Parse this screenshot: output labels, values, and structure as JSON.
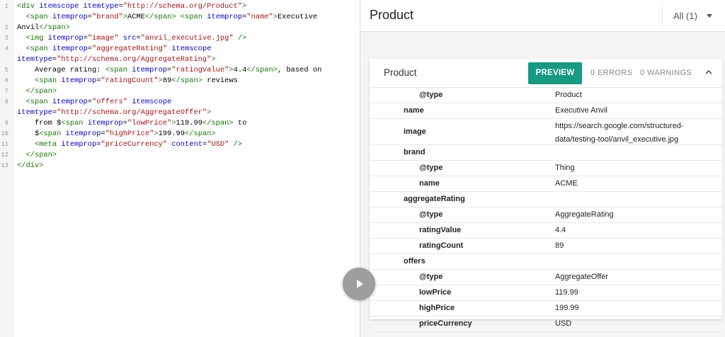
{
  "code": {
    "lines": [
      [
        {
          "t": "tag",
          "s": "<div "
        },
        {
          "t": "attr",
          "s": "itemscope itemtype"
        },
        {
          "t": "txt",
          "s": "="
        },
        {
          "t": "str",
          "s": "\"http://schema.org/Product\""
        },
        {
          "t": "tag",
          "s": ">"
        }
      ],
      [
        {
          "t": "txt",
          "s": "  "
        },
        {
          "t": "tag",
          "s": "<span "
        },
        {
          "t": "attr",
          "s": "itemprop"
        },
        {
          "t": "txt",
          "s": "="
        },
        {
          "t": "str",
          "s": "\"brand\""
        },
        {
          "t": "tag",
          "s": ">"
        },
        {
          "t": "txt",
          "s": "ACME"
        },
        {
          "t": "tag",
          "s": "</span>"
        },
        {
          "t": "txt",
          "s": " "
        },
        {
          "t": "tag",
          "s": "<span "
        },
        {
          "t": "attr",
          "s": "itemprop"
        },
        {
          "t": "txt",
          "s": "="
        },
        {
          "t": "str",
          "s": "\"name\""
        },
        {
          "t": "tag",
          "s": ">"
        },
        {
          "t": "txt",
          "s": "Executive"
        }
      ],
      [
        {
          "t": "txt",
          "s": "Anvil"
        },
        {
          "t": "tag",
          "s": "</span>"
        }
      ],
      [
        {
          "t": "txt",
          "s": "  "
        },
        {
          "t": "tag",
          "s": "<img "
        },
        {
          "t": "attr",
          "s": "itemprop"
        },
        {
          "t": "txt",
          "s": "="
        },
        {
          "t": "str",
          "s": "\"image\""
        },
        {
          "t": "txt",
          "s": " "
        },
        {
          "t": "attr",
          "s": "src"
        },
        {
          "t": "txt",
          "s": "="
        },
        {
          "t": "str",
          "s": "\"anvil_executive.jpg\""
        },
        {
          "t": "txt",
          "s": " "
        },
        {
          "t": "tag",
          "s": "/>"
        }
      ],
      [
        {
          "t": "txt",
          "s": "  "
        },
        {
          "t": "tag",
          "s": "<span "
        },
        {
          "t": "attr",
          "s": "itemprop"
        },
        {
          "t": "txt",
          "s": "="
        },
        {
          "t": "str",
          "s": "\"aggregateRating\""
        },
        {
          "t": "txt",
          "s": " "
        },
        {
          "t": "attr",
          "s": "itemscope"
        }
      ],
      [
        {
          "t": "attr",
          "s": "itemtype"
        },
        {
          "t": "txt",
          "s": "="
        },
        {
          "t": "str",
          "s": "\"http://schema.org/AggregateRating\""
        },
        {
          "t": "tag",
          "s": ">"
        }
      ],
      [
        {
          "t": "txt",
          "s": "    Average rating: "
        },
        {
          "t": "tag",
          "s": "<span "
        },
        {
          "t": "attr",
          "s": "itemprop"
        },
        {
          "t": "txt",
          "s": "="
        },
        {
          "t": "str",
          "s": "\"ratingValue\""
        },
        {
          "t": "tag",
          "s": ">"
        },
        {
          "t": "txt",
          "s": "4.4"
        },
        {
          "t": "tag",
          "s": "</span>"
        },
        {
          "t": "txt",
          "s": ", based on"
        }
      ],
      [
        {
          "t": "txt",
          "s": "    "
        },
        {
          "t": "tag",
          "s": "<span "
        },
        {
          "t": "attr",
          "s": "itemprop"
        },
        {
          "t": "txt",
          "s": "="
        },
        {
          "t": "str",
          "s": "\"ratingCount\""
        },
        {
          "t": "tag",
          "s": ">"
        },
        {
          "t": "txt",
          "s": "89"
        },
        {
          "t": "tag",
          "s": "</span>"
        },
        {
          "t": "txt",
          "s": " reviews"
        }
      ],
      [
        {
          "t": "txt",
          "s": "  "
        },
        {
          "t": "tag",
          "s": "</span>"
        }
      ],
      [
        {
          "t": "txt",
          "s": "  "
        },
        {
          "t": "tag",
          "s": "<span "
        },
        {
          "t": "attr",
          "s": "itemprop"
        },
        {
          "t": "txt",
          "s": "="
        },
        {
          "t": "str",
          "s": "\"offers\""
        },
        {
          "t": "txt",
          "s": " "
        },
        {
          "t": "attr",
          "s": "itemscope"
        }
      ],
      [
        {
          "t": "attr",
          "s": "itemtype"
        },
        {
          "t": "txt",
          "s": "="
        },
        {
          "t": "str",
          "s": "\"http://schema.org/AggregateOffer\""
        },
        {
          "t": "tag",
          "s": ">"
        }
      ],
      [
        {
          "t": "txt",
          "s": "    from $"
        },
        {
          "t": "tag",
          "s": "<span "
        },
        {
          "t": "attr",
          "s": "itemprop"
        },
        {
          "t": "txt",
          "s": "="
        },
        {
          "t": "str",
          "s": "\"lowPrice\""
        },
        {
          "t": "tag",
          "s": ">"
        },
        {
          "t": "txt",
          "s": "119.99"
        },
        {
          "t": "tag",
          "s": "</span>"
        },
        {
          "t": "txt",
          "s": " to"
        }
      ],
      [
        {
          "t": "txt",
          "s": "    $"
        },
        {
          "t": "tag",
          "s": "<span "
        },
        {
          "t": "attr",
          "s": "itemprop"
        },
        {
          "t": "txt",
          "s": "="
        },
        {
          "t": "str",
          "s": "\"highPrice\""
        },
        {
          "t": "tag",
          "s": ">"
        },
        {
          "t": "txt",
          "s": "199.99"
        },
        {
          "t": "tag",
          "s": "</span>"
        }
      ],
      [
        {
          "t": "txt",
          "s": "    "
        },
        {
          "t": "tag",
          "s": "<meta "
        },
        {
          "t": "attr",
          "s": "itemprop"
        },
        {
          "t": "txt",
          "s": "="
        },
        {
          "t": "str",
          "s": "\"priceCurrency\""
        },
        {
          "t": "txt",
          "s": " "
        },
        {
          "t": "attr",
          "s": "content"
        },
        {
          "t": "txt",
          "s": "="
        },
        {
          "t": "str",
          "s": "\"USD\""
        },
        {
          "t": "txt",
          "s": " "
        },
        {
          "t": "tag",
          "s": "/>"
        }
      ],
      [
        {
          "t": "txt",
          "s": "  "
        },
        {
          "t": "tag",
          "s": "</span>"
        }
      ],
      [
        {
          "t": "tag",
          "s": "</div>"
        }
      ]
    ],
    "line_numbers": [
      "1",
      "",
      "2",
      "3",
      "4",
      "",
      "5",
      "6",
      "7",
      "8",
      "",
      "9",
      "10",
      "11",
      "12",
      "13"
    ]
  },
  "panel": {
    "title": "Product",
    "filter": "All (1)"
  },
  "card": {
    "title": "Product",
    "preview_label": "PREVIEW",
    "errors_label": "0 ERRORS",
    "warnings_label": "0 WARNINGS",
    "rows": [
      {
        "key": "@type",
        "value": "Product",
        "indent": 1
      },
      {
        "key": "name",
        "value": "Executive Anvil",
        "indent": 0
      },
      {
        "key": "image",
        "value": "https://search.google.com/structured-data/testing-tool/anvil_executive.jpg",
        "indent": 0,
        "tall": true
      },
      {
        "key": "brand",
        "value": "",
        "indent": 0
      },
      {
        "key": "@type",
        "value": "Thing",
        "indent": 1
      },
      {
        "key": "name",
        "value": "ACME",
        "indent": 1
      },
      {
        "key": "aggregateRating",
        "value": "",
        "indent": 0
      },
      {
        "key": "@type",
        "value": "AggregateRating",
        "indent": 1
      },
      {
        "key": "ratingValue",
        "value": "4.4",
        "indent": 1
      },
      {
        "key": "ratingCount",
        "value": "89",
        "indent": 1
      },
      {
        "key": "offers",
        "value": "",
        "indent": 0
      },
      {
        "key": "@type",
        "value": "AggregateOffer",
        "indent": 1
      },
      {
        "key": "lowPrice",
        "value": "119.99",
        "indent": 1
      },
      {
        "key": "highPrice",
        "value": "199.99",
        "indent": 1
      },
      {
        "key": "priceCurrency",
        "value": "USD",
        "indent": 1
      }
    ]
  },
  "colors": {
    "preview_button": "#169a82",
    "tag": "#117700",
    "attr": "#0000cc",
    "string": "#aa1111"
  },
  "icons": {
    "play": "play-icon",
    "caret": "caret-down-icon",
    "collapse": "chevron-up-icon"
  }
}
